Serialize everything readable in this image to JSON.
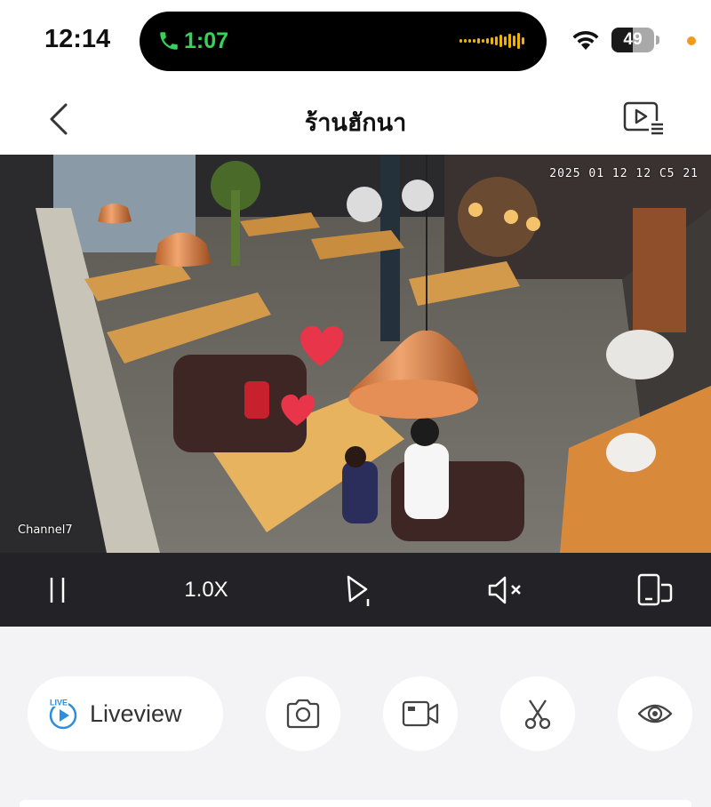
{
  "status_bar": {
    "time": "12:14",
    "call_duration": "1:07",
    "battery_level": "49",
    "battery_fraction": 0.49,
    "call_color": "#35d35a",
    "recording_dot_color": "#f39a1d"
  },
  "nav": {
    "title": "ร้านฮักนา",
    "back_icon": "chevron-left-icon",
    "playback_icon": "playback-list-icon"
  },
  "camera": {
    "timestamp": "2025 01 12 12 C5 21",
    "channel": "Channel7"
  },
  "controls": {
    "pause_icon": "pause-icon",
    "speed": "1.0X",
    "next_icon": "play-next-icon",
    "mute_icon": "mute-icon",
    "orientation_icon": "rotate-screen-icon"
  },
  "actions": {
    "liveview_badge": "LIVE",
    "liveview_label": "Liveview",
    "liveview_color": "#2a8ee0",
    "buttons": [
      "camera-icon",
      "video-record-icon",
      "scissors-icon",
      "eye-icon"
    ]
  }
}
